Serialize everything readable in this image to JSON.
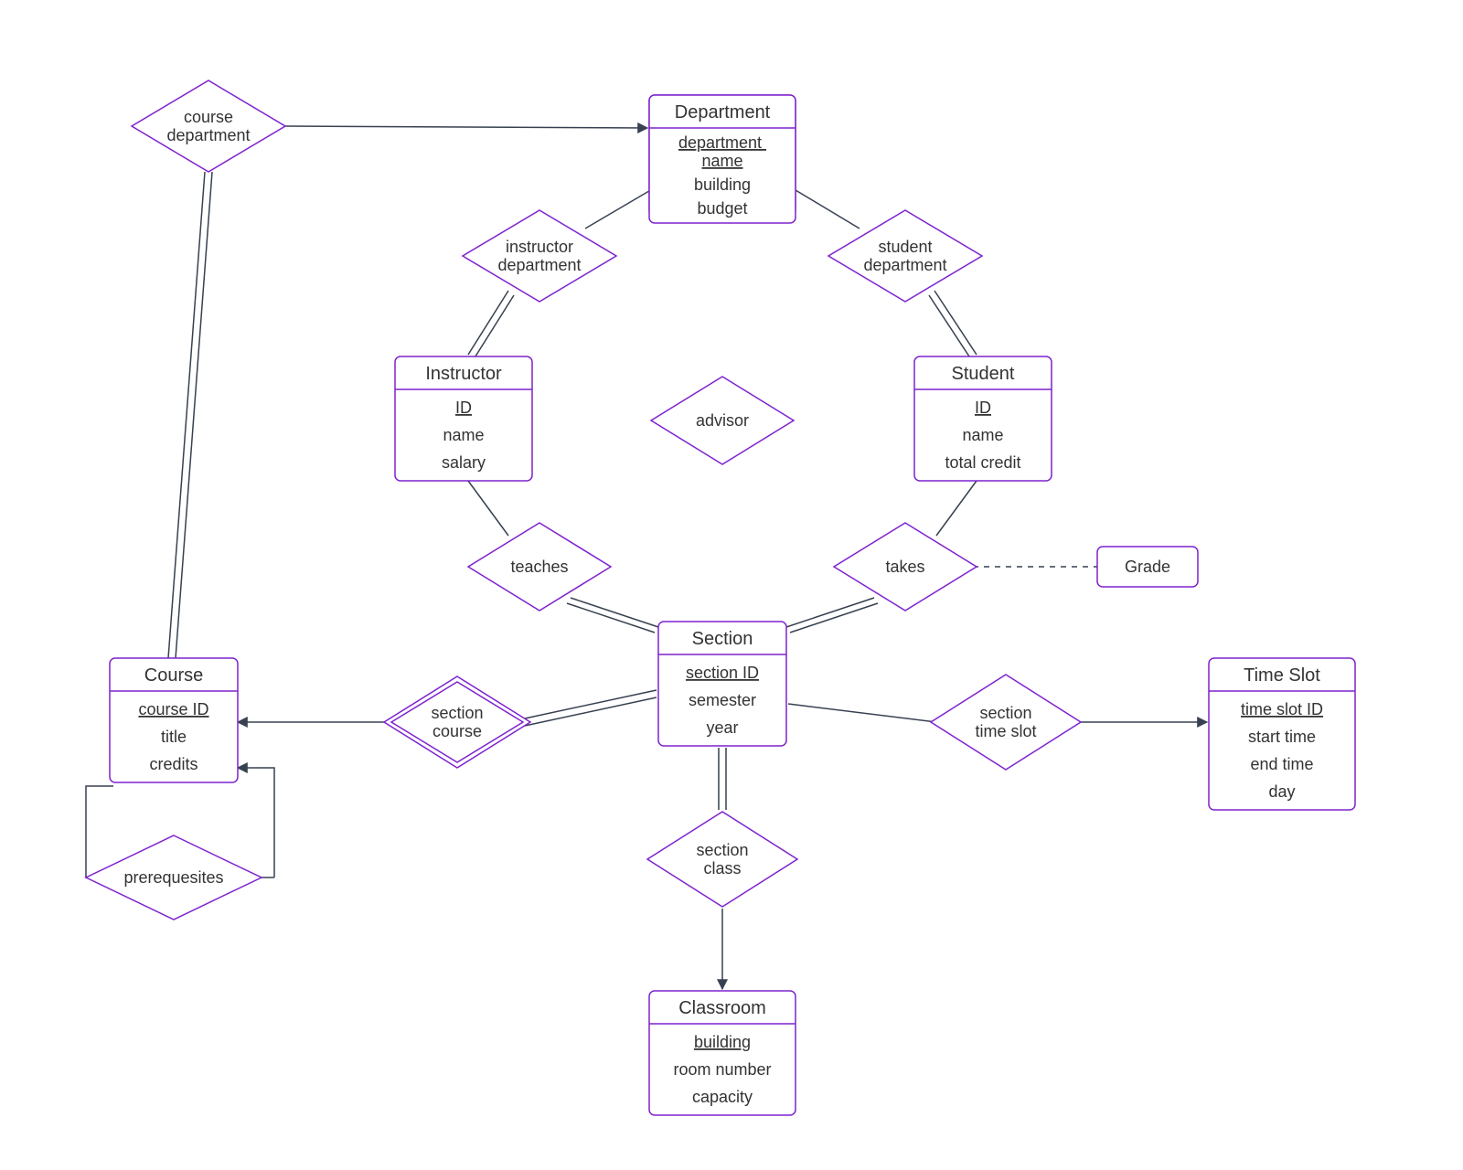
{
  "entities": {
    "department": {
      "title": "Department",
      "key": "department name",
      "a2": "building",
      "a3": "budget"
    },
    "instructor": {
      "title": "Instructor",
      "key": "ID",
      "a2": "name",
      "a3": "salary"
    },
    "student": {
      "title": "Student",
      "key": "ID",
      "a2": "name",
      "a3": "total credit"
    },
    "course": {
      "title": "Course",
      "key": "course ID",
      "a2": "title",
      "a3": "credits"
    },
    "section": {
      "title": "Section",
      "key": "section ID",
      "a2": "semester",
      "a3": "year"
    },
    "classroom": {
      "title": "Classroom",
      "key": "building",
      "a2": "room number",
      "a3": "capacity"
    },
    "timeslot": {
      "title": "Time Slot",
      "key": "time slot ID",
      "a2": "start time",
      "a3": "end time",
      "a4": "day"
    }
  },
  "relationships": {
    "course_department": {
      "l1": "course",
      "l2": "department"
    },
    "instructor_department": {
      "l1": "instructor",
      "l2": "department"
    },
    "student_department": {
      "l1": "student",
      "l2": "department"
    },
    "advisor": {
      "l1": "advisor"
    },
    "teaches": {
      "l1": "teaches"
    },
    "takes": {
      "l1": "takes"
    },
    "section_course": {
      "l1": "section",
      "l2": "course"
    },
    "section_class": {
      "l1": "section",
      "l2": "class"
    },
    "section_timeslot": {
      "l1": "section",
      "l2": "time slot"
    },
    "prerequisites": {
      "l1": "prerequesites"
    }
  },
  "assoc": {
    "grade": "Grade"
  }
}
